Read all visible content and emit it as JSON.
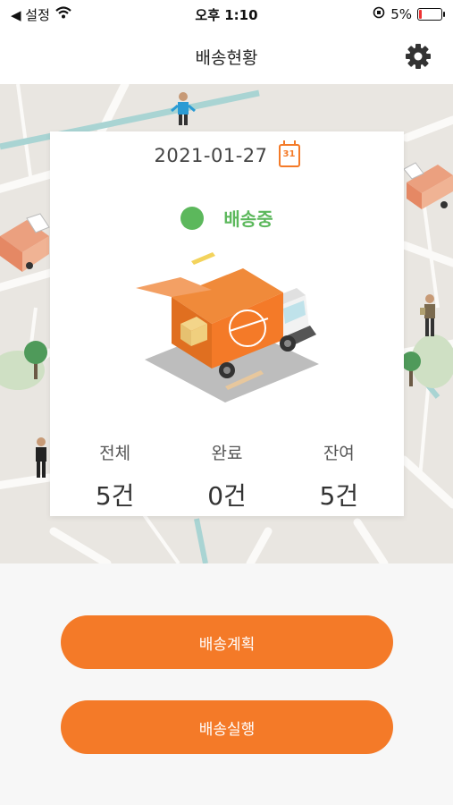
{
  "status_bar": {
    "back_label": "◀ 설정",
    "time": "오후 1:10",
    "battery": "5%"
  },
  "header": {
    "title": "배송현황"
  },
  "card": {
    "date": "2021-01-27",
    "calendar_day": "31",
    "status": "배송중",
    "stats": [
      {
        "label": "전체",
        "value": "5건"
      },
      {
        "label": "완료",
        "value": "0건"
      },
      {
        "label": "잔여",
        "value": "5건"
      }
    ]
  },
  "actions": {
    "plan_label": "배송계획",
    "execute_label": "배송실행"
  },
  "colors": {
    "accent": "#f47a28",
    "status_green": "#5cb85c",
    "map_bg": "#e9e6e1"
  }
}
